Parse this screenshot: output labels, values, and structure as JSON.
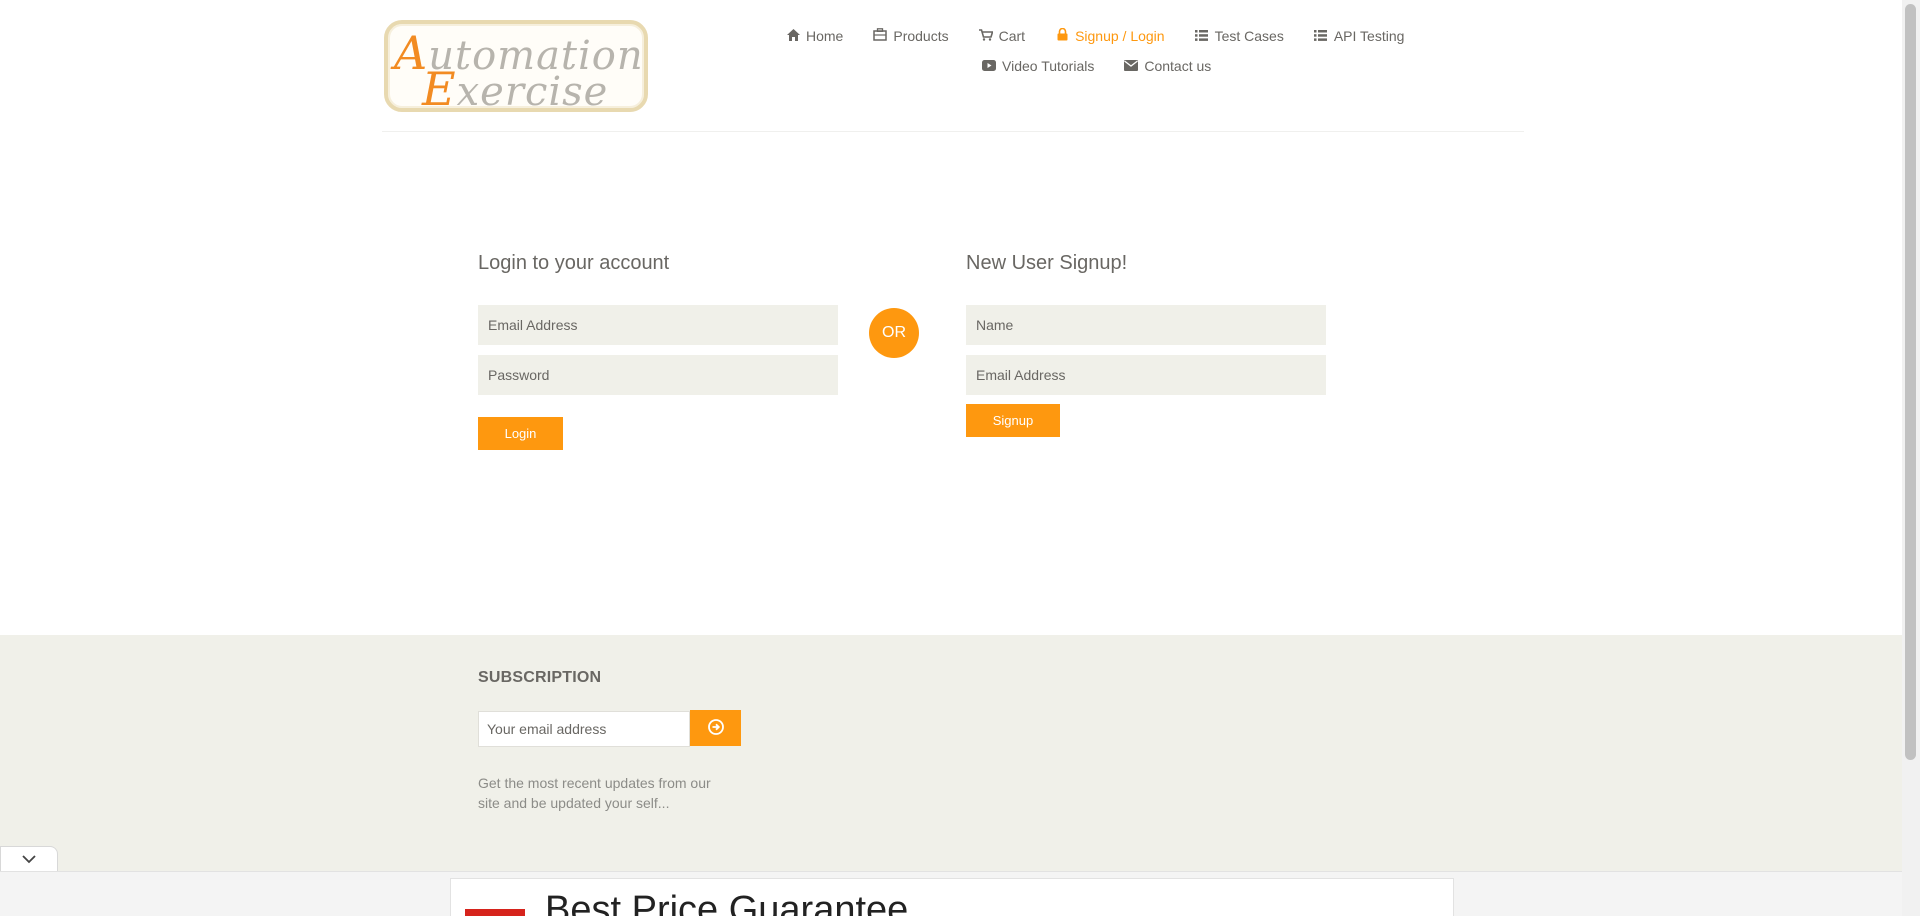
{
  "logo": {
    "line1_cap": "A",
    "line1_rest": "utomation",
    "line2_cap": "E",
    "line2_rest": "xercise"
  },
  "nav": {
    "items": [
      {
        "label": "Home",
        "icon": "home-icon"
      },
      {
        "label": "Products",
        "icon": "briefcase-icon"
      },
      {
        "label": "Cart",
        "icon": "cart-icon"
      },
      {
        "label": "Signup / Login",
        "icon": "lock-icon"
      },
      {
        "label": "Test Cases",
        "icon": "list-icon"
      },
      {
        "label": "API Testing",
        "icon": "list-icon"
      },
      {
        "label": "Video Tutorials",
        "icon": "youtube-icon"
      },
      {
        "label": "Contact us",
        "icon": "envelope-icon"
      }
    ],
    "active": "Signup / Login"
  },
  "login": {
    "title": "Login to your account",
    "email_placeholder": "Email Address",
    "password_placeholder": "Password",
    "button": "Login"
  },
  "or_label": "OR",
  "signup": {
    "title": "New User Signup!",
    "name_placeholder": "Name",
    "email_placeholder": "Email Address",
    "button": "Signup"
  },
  "footer": {
    "subscription_title": "SUBSCRIPTION",
    "email_placeholder": "Your email address",
    "description": "Get the most recent updates from our site and be updated your self..."
  },
  "ad": {
    "headline": "Best Price Guarantee"
  },
  "colors": {
    "accent": "#fe980f",
    "text": "#696763",
    "input_bg": "#f0f0e9"
  }
}
